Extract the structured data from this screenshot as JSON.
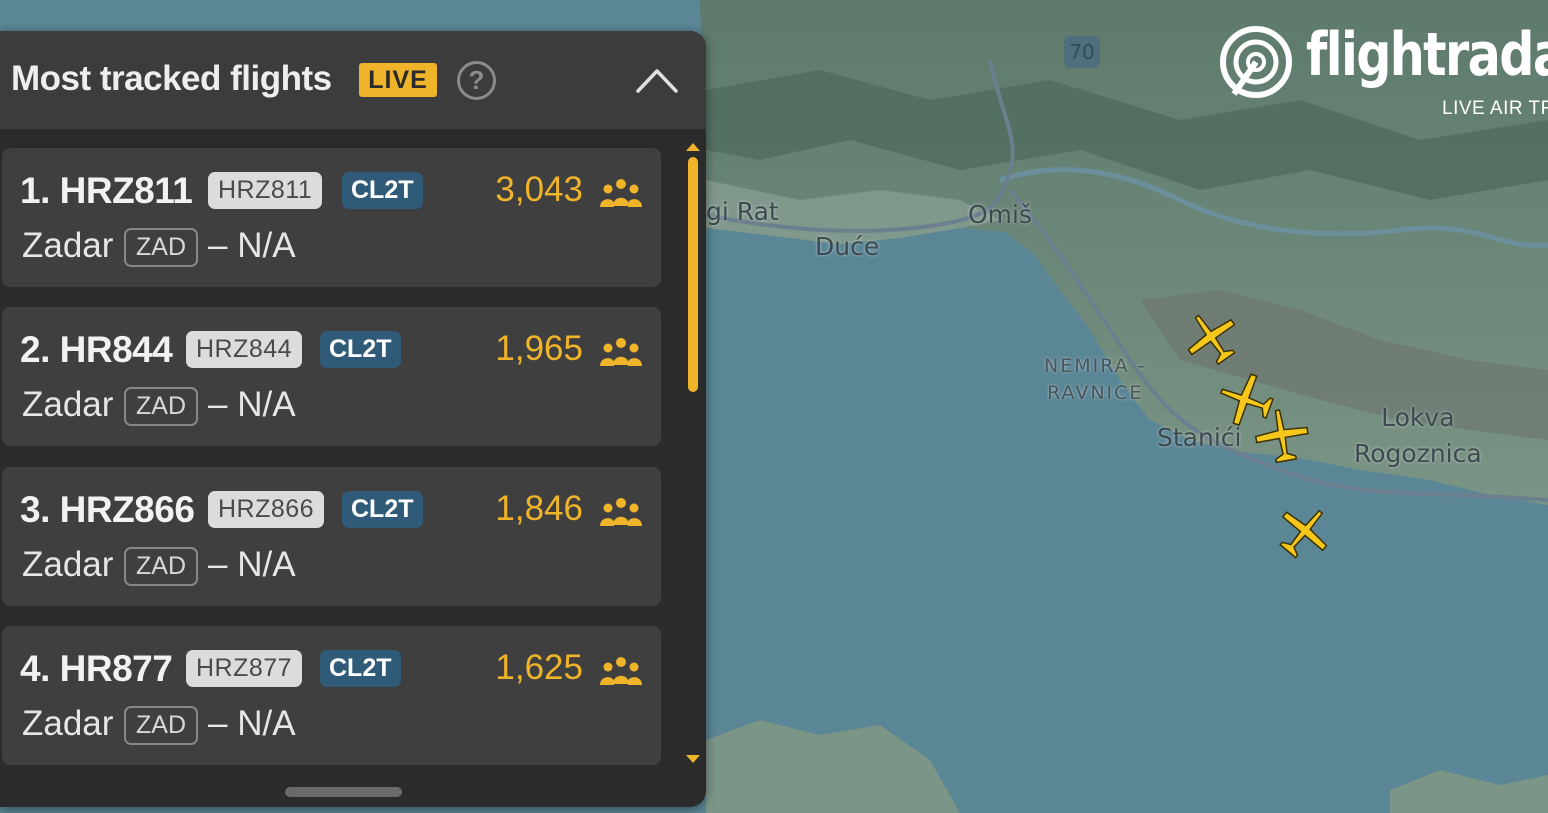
{
  "panel": {
    "title": "Most tracked flights",
    "live_badge": "LIVE",
    "help_label": "?",
    "flights": [
      {
        "rank_callsign": "1. HRZ811",
        "callsign_badge": "HRZ811",
        "aircraft_type": "CL2T",
        "tracking_count": "3,043",
        "origin_city": "Zadar",
        "origin_iata": "ZAD",
        "destination": "– N/A"
      },
      {
        "rank_callsign": "2. HR844",
        "callsign_badge": "HRZ844",
        "aircraft_type": "CL2T",
        "tracking_count": "1,965",
        "origin_city": "Zadar",
        "origin_iata": "ZAD",
        "destination": "– N/A"
      },
      {
        "rank_callsign": "3. HRZ866",
        "callsign_badge": "HRZ866",
        "aircraft_type": "CL2T",
        "tracking_count": "1,846",
        "origin_city": "Zadar",
        "origin_iata": "ZAD",
        "destination": "– N/A"
      },
      {
        "rank_callsign": "4. HR877",
        "callsign_badge": "HRZ877",
        "aircraft_type": "CL2T",
        "tracking_count": "1,625",
        "origin_city": "Zadar",
        "origin_iata": "ZAD",
        "destination": "– N/A"
      }
    ]
  },
  "map": {
    "road_number": "70",
    "labels": {
      "rat": "gi Rat",
      "duce": "Duće",
      "omis": "Omiš",
      "nemira_line1": "NEMIRA -",
      "nemira_line2": "RAVNICE",
      "stanici": "Stanići",
      "lokva_line1": "Lokva",
      "lokva_line2": "Rogoznica"
    }
  },
  "logo": {
    "text": "flightradar",
    "tagline": "LIVE AIR TR"
  },
  "colors": {
    "accent": "#f0b42a",
    "panel_bg": "#2b2b2b",
    "card_bg": "#3f3f3f",
    "type_badge": "#2f5a78",
    "sea": "#5a8696"
  }
}
